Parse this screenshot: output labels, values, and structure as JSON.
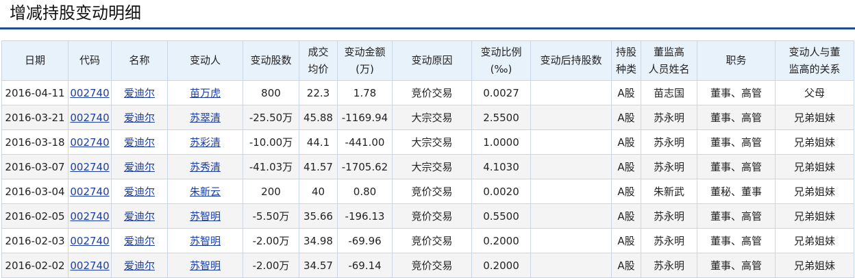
{
  "page": {
    "title": "增减持股变动明细"
  },
  "columns": [
    {
      "line1": "日期",
      "line2": ""
    },
    {
      "line1": "代码",
      "line2": ""
    },
    {
      "line1": "名称",
      "line2": ""
    },
    {
      "line1": "变动人",
      "line2": ""
    },
    {
      "line1": "变动股数",
      "line2": ""
    },
    {
      "line1": "成交",
      "line2": "均价"
    },
    {
      "line1": "变动金额",
      "line2": "(万)"
    },
    {
      "line1": "变动原因",
      "line2": ""
    },
    {
      "line1": "变动比例",
      "line2": "(‰)"
    },
    {
      "line1": "变动后持股数",
      "line2": ""
    },
    {
      "line1": "持股",
      "line2": "种类"
    },
    {
      "line1": "董监高",
      "line2": "人员姓名"
    },
    {
      "line1": "职务",
      "line2": ""
    },
    {
      "line1": "变动人与董",
      "line2": "监高的关系"
    }
  ],
  "rows": [
    {
      "date": "2016-04-11",
      "code": "002740",
      "name": "爱迪尔",
      "changer": "苗万虎",
      "shares": "800",
      "avg_price": "22.3",
      "amount": "1.78",
      "reason": "竞价交易",
      "ratio": "0.0027",
      "after": "",
      "type": "A股",
      "executive": "苗志国",
      "position": "董事、高管",
      "relation": "父母"
    },
    {
      "date": "2016-03-21",
      "code": "002740",
      "name": "爱迪尔",
      "changer": "苏翠清",
      "shares": "-25.50万",
      "avg_price": "45.88",
      "amount": "-1169.94",
      "reason": "大宗交易",
      "ratio": "2.5500",
      "after": "",
      "type": "A股",
      "executive": "苏永明",
      "position": "董事、高管",
      "relation": "兄弟姐妹"
    },
    {
      "date": "2016-03-18",
      "code": "002740",
      "name": "爱迪尔",
      "changer": "苏彩清",
      "shares": "-10.00万",
      "avg_price": "44.1",
      "amount": "-441.00",
      "reason": "大宗交易",
      "ratio": "1.0000",
      "after": "",
      "type": "A股",
      "executive": "苏永明",
      "position": "董事、高管",
      "relation": "兄弟姐妹"
    },
    {
      "date": "2016-03-07",
      "code": "002740",
      "name": "爱迪尔",
      "changer": "苏秀清",
      "shares": "-41.03万",
      "avg_price": "41.57",
      "amount": "-1705.62",
      "reason": "大宗交易",
      "ratio": "4.1030",
      "after": "",
      "type": "A股",
      "executive": "苏永明",
      "position": "董事、高管",
      "relation": "兄弟姐妹"
    },
    {
      "date": "2016-03-04",
      "code": "002740",
      "name": "爱迪尔",
      "changer": "朱新云",
      "shares": "200",
      "avg_price": "40",
      "amount": "0.80",
      "reason": "竞价交易",
      "ratio": "0.0020",
      "after": "",
      "type": "A股",
      "executive": "朱新武",
      "position": "董秘、董事",
      "relation": "兄弟姐妹"
    },
    {
      "date": "2016-02-05",
      "code": "002740",
      "name": "爱迪尔",
      "changer": "苏智明",
      "shares": "-5.50万",
      "avg_price": "35.66",
      "amount": "-196.13",
      "reason": "竞价交易",
      "ratio": "0.5500",
      "after": "",
      "type": "A股",
      "executive": "苏永明",
      "position": "董事、高管",
      "relation": "兄弟姐妹"
    },
    {
      "date": "2016-02-03",
      "code": "002740",
      "name": "爱迪尔",
      "changer": "苏智明",
      "shares": "-2.00万",
      "avg_price": "34.98",
      "amount": "-69.96",
      "reason": "竞价交易",
      "ratio": "0.2000",
      "after": "",
      "type": "A股",
      "executive": "苏永明",
      "position": "董事、高管",
      "relation": "兄弟姐妹"
    },
    {
      "date": "2016-02-02",
      "code": "002740",
      "name": "爱迪尔",
      "changer": "苏智明",
      "shares": "-2.00万",
      "avg_price": "34.57",
      "amount": "-69.14",
      "reason": "竞价交易",
      "ratio": "0.2000",
      "after": "",
      "type": "A股",
      "executive": "苏永明",
      "position": "董事、高管",
      "relation": "兄弟姐妹"
    }
  ],
  "colors": {
    "link": "#1a3ea6",
    "header_bg": "#e8f2fb",
    "title_rule": "#1f4e8c",
    "border": "#c9d6e6"
  }
}
